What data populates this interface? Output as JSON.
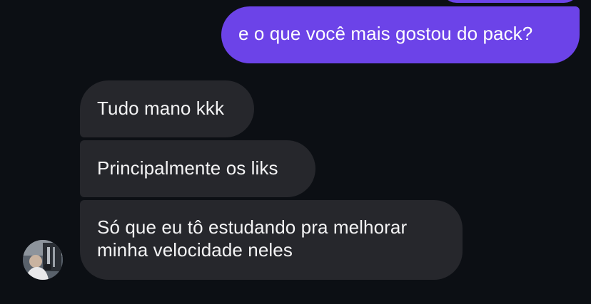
{
  "conversation": {
    "messages": [
      {
        "sender": "me",
        "text": "e o que você mais gostou do pack?"
      },
      {
        "sender": "contact",
        "text": "Tudo mano kkk"
      },
      {
        "sender": "contact",
        "text": "Principalmente os liks"
      },
      {
        "sender": "contact",
        "lines": [
          "Só que eu tô estudando pra melhorar",
          "minha velocidade neles"
        ]
      }
    ]
  },
  "colors": {
    "background": "#0c0f14",
    "sent_bubble": "#6c43e8",
    "received_bubble": "#26272c",
    "text": "#ffffff"
  }
}
